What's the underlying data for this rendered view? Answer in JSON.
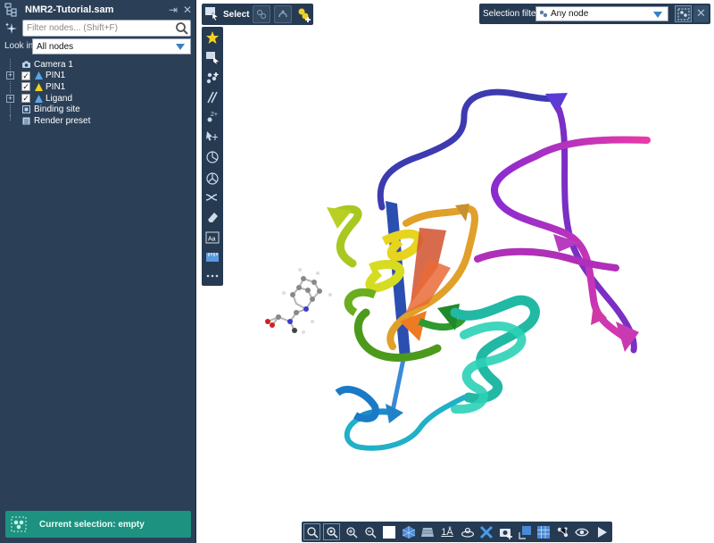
{
  "document": {
    "title": "NMR2-Tutorial.sam",
    "filter_placeholder": "Filter nodes... (Shift+F)",
    "look_in_label": "Look in",
    "look_in_value": "All nodes",
    "tree": [
      {
        "label": "Camera 1",
        "icon": "camera-icon",
        "checkbox": false,
        "expander": false
      },
      {
        "label": "PIN1",
        "icon": "structural-model-icon",
        "checkbox": true,
        "expander": true
      },
      {
        "label": "PIN1",
        "icon": "yellow-model-icon",
        "checkbox": true,
        "expander": false
      },
      {
        "label": "Ligand",
        "icon": "structural-model-icon",
        "checkbox": true,
        "expander": true
      },
      {
        "label": "Binding site",
        "icon": "selection-group-icon",
        "checkbox": false,
        "expander": false
      },
      {
        "label": "Render preset",
        "icon": "render-preset-icon",
        "checkbox": false,
        "expander": false
      }
    ],
    "current_selection": "Current selection: empty"
  },
  "select_toolbar": {
    "label": "Select"
  },
  "selection_filter": {
    "label": "Selection filter",
    "value": "Any node"
  },
  "bottom_toolbar": {
    "text_label": "1Å"
  },
  "vertical_toolbar": {
    "label_tool_text": "Aa",
    "counter_text": "2+"
  },
  "colors": {
    "panel_bg": "#2b3f57",
    "toolbar_bg": "#263a52",
    "selection_bar": "#1e9281",
    "accent_blue": "#3a80c6"
  }
}
